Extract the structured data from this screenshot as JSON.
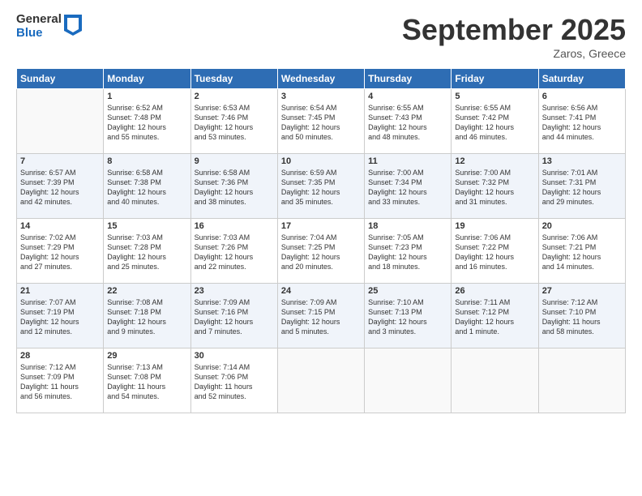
{
  "logo": {
    "line1": "General",
    "line2": "Blue"
  },
  "title": "September 2025",
  "subtitle": "Zaros, Greece",
  "days_header": [
    "Sunday",
    "Monday",
    "Tuesday",
    "Wednesday",
    "Thursday",
    "Friday",
    "Saturday"
  ],
  "weeks": [
    [
      {
        "num": "",
        "info": ""
      },
      {
        "num": "1",
        "info": "Sunrise: 6:52 AM\nSunset: 7:48 PM\nDaylight: 12 hours\nand 55 minutes."
      },
      {
        "num": "2",
        "info": "Sunrise: 6:53 AM\nSunset: 7:46 PM\nDaylight: 12 hours\nand 53 minutes."
      },
      {
        "num": "3",
        "info": "Sunrise: 6:54 AM\nSunset: 7:45 PM\nDaylight: 12 hours\nand 50 minutes."
      },
      {
        "num": "4",
        "info": "Sunrise: 6:55 AM\nSunset: 7:43 PM\nDaylight: 12 hours\nand 48 minutes."
      },
      {
        "num": "5",
        "info": "Sunrise: 6:55 AM\nSunset: 7:42 PM\nDaylight: 12 hours\nand 46 minutes."
      },
      {
        "num": "6",
        "info": "Sunrise: 6:56 AM\nSunset: 7:41 PM\nDaylight: 12 hours\nand 44 minutes."
      }
    ],
    [
      {
        "num": "7",
        "info": "Sunrise: 6:57 AM\nSunset: 7:39 PM\nDaylight: 12 hours\nand 42 minutes."
      },
      {
        "num": "8",
        "info": "Sunrise: 6:58 AM\nSunset: 7:38 PM\nDaylight: 12 hours\nand 40 minutes."
      },
      {
        "num": "9",
        "info": "Sunrise: 6:58 AM\nSunset: 7:36 PM\nDaylight: 12 hours\nand 38 minutes."
      },
      {
        "num": "10",
        "info": "Sunrise: 6:59 AM\nSunset: 7:35 PM\nDaylight: 12 hours\nand 35 minutes."
      },
      {
        "num": "11",
        "info": "Sunrise: 7:00 AM\nSunset: 7:34 PM\nDaylight: 12 hours\nand 33 minutes."
      },
      {
        "num": "12",
        "info": "Sunrise: 7:00 AM\nSunset: 7:32 PM\nDaylight: 12 hours\nand 31 minutes."
      },
      {
        "num": "13",
        "info": "Sunrise: 7:01 AM\nSunset: 7:31 PM\nDaylight: 12 hours\nand 29 minutes."
      }
    ],
    [
      {
        "num": "14",
        "info": "Sunrise: 7:02 AM\nSunset: 7:29 PM\nDaylight: 12 hours\nand 27 minutes."
      },
      {
        "num": "15",
        "info": "Sunrise: 7:03 AM\nSunset: 7:28 PM\nDaylight: 12 hours\nand 25 minutes."
      },
      {
        "num": "16",
        "info": "Sunrise: 7:03 AM\nSunset: 7:26 PM\nDaylight: 12 hours\nand 22 minutes."
      },
      {
        "num": "17",
        "info": "Sunrise: 7:04 AM\nSunset: 7:25 PM\nDaylight: 12 hours\nand 20 minutes."
      },
      {
        "num": "18",
        "info": "Sunrise: 7:05 AM\nSunset: 7:23 PM\nDaylight: 12 hours\nand 18 minutes."
      },
      {
        "num": "19",
        "info": "Sunrise: 7:06 AM\nSunset: 7:22 PM\nDaylight: 12 hours\nand 16 minutes."
      },
      {
        "num": "20",
        "info": "Sunrise: 7:06 AM\nSunset: 7:21 PM\nDaylight: 12 hours\nand 14 minutes."
      }
    ],
    [
      {
        "num": "21",
        "info": "Sunrise: 7:07 AM\nSunset: 7:19 PM\nDaylight: 12 hours\nand 12 minutes."
      },
      {
        "num": "22",
        "info": "Sunrise: 7:08 AM\nSunset: 7:18 PM\nDaylight: 12 hours\nand 9 minutes."
      },
      {
        "num": "23",
        "info": "Sunrise: 7:09 AM\nSunset: 7:16 PM\nDaylight: 12 hours\nand 7 minutes."
      },
      {
        "num": "24",
        "info": "Sunrise: 7:09 AM\nSunset: 7:15 PM\nDaylight: 12 hours\nand 5 minutes."
      },
      {
        "num": "25",
        "info": "Sunrise: 7:10 AM\nSunset: 7:13 PM\nDaylight: 12 hours\nand 3 minutes."
      },
      {
        "num": "26",
        "info": "Sunrise: 7:11 AM\nSunset: 7:12 PM\nDaylight: 12 hours\nand 1 minute."
      },
      {
        "num": "27",
        "info": "Sunrise: 7:12 AM\nSunset: 7:10 PM\nDaylight: 11 hours\nand 58 minutes."
      }
    ],
    [
      {
        "num": "28",
        "info": "Sunrise: 7:12 AM\nSunset: 7:09 PM\nDaylight: 11 hours\nand 56 minutes."
      },
      {
        "num": "29",
        "info": "Sunrise: 7:13 AM\nSunset: 7:08 PM\nDaylight: 11 hours\nand 54 minutes."
      },
      {
        "num": "30",
        "info": "Sunrise: 7:14 AM\nSunset: 7:06 PM\nDaylight: 11 hours\nand 52 minutes."
      },
      {
        "num": "",
        "info": ""
      },
      {
        "num": "",
        "info": ""
      },
      {
        "num": "",
        "info": ""
      },
      {
        "num": "",
        "info": ""
      }
    ]
  ]
}
